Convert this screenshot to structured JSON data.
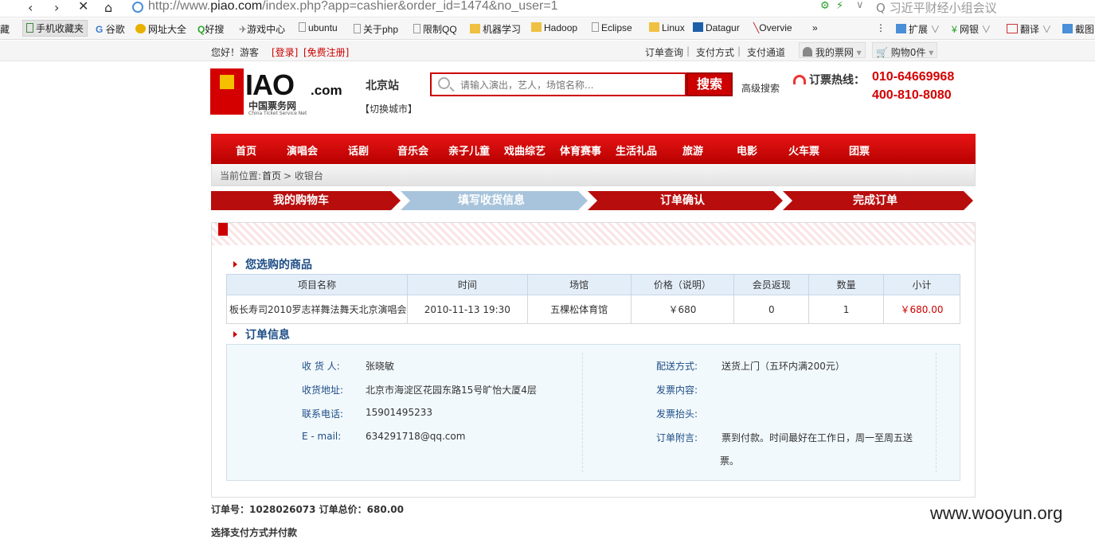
{
  "browser": {
    "url_prefix": "http://www.",
    "url_host": "piao.com",
    "url_path": "/index.php?app=cashier&order_id=1474&no_user=1",
    "search_text": "习近平财经小组会议",
    "bookmarks": [
      "藏",
      "手机收藏夹",
      "谷歌",
      "网址大全",
      "好搜",
      "游戏中心",
      "ubuntu",
      "关于php",
      "限制QQ",
      "机器学习",
      "Hadoop",
      "Eclipse",
      "Linux",
      "Datagur",
      "Overvie",
      "»"
    ],
    "toolbar": [
      "扩展",
      "网银",
      "翻译",
      "截图"
    ]
  },
  "sitebar": {
    "greeting": "您好！游客",
    "login": "[登录]",
    "register": "[免费注册]",
    "links": [
      "订单查询",
      "支付方式",
      "支付通道"
    ],
    "my_account": "我的票网",
    "cart": "购物0件"
  },
  "header": {
    "logo_p": "P",
    "logo_iao": "IAO",
    "logo_com": ".com",
    "logo_cn": "中国票务网",
    "logo_en": "China Ticket Service Net",
    "city": "北京站",
    "city_switch": "【切换城市】",
    "search_placeholder": "请输入演出，艺人，场馆名称...",
    "search_button": "搜索",
    "advanced_search": "高级搜索",
    "hotline_label": "订票热线：",
    "hotline_1": "010-64669968",
    "hotline_2": "400-810-8080"
  },
  "nav": [
    "首页",
    "演唱会",
    "话剧",
    "音乐会",
    "亲子儿童",
    "戏曲综艺",
    "体育赛事",
    "生活礼品",
    "旅游",
    "电影",
    "火车票",
    "团票"
  ],
  "breadcrumb": {
    "prefix": "当前位置:",
    "home": "首页",
    "current": "> 收银台"
  },
  "steps": [
    "我的购物车",
    "填写收货信息",
    "订单确认",
    "完成订单"
  ],
  "goods": {
    "title": "您选购的商品",
    "columns": [
      "项目名称",
      "时间",
      "场馆",
      "价格（说明）",
      "会员返现",
      "数量",
      "小计"
    ],
    "rows": [
      [
        "板长寿司2010罗志祥舞法舞天北京演唱会",
        "2010-11-13 19:30",
        "五棵松体育馆",
        "￥680",
        "0",
        "1",
        "￥680.00"
      ]
    ]
  },
  "order_info": {
    "title": "订单信息",
    "left": [
      {
        "label": "收 货 人:",
        "value": "张晓敏"
      },
      {
        "label": "收货地址:",
        "value": "北京市海淀区花园东路15号旷怡大厦4层"
      },
      {
        "label": "联系电话:",
        "value": "15901495233"
      },
      {
        "label": "E - mail:",
        "value": "634291718@qq.com"
      }
    ],
    "right": [
      {
        "label": "配送方式:",
        "value": "送货上门（五环内满200元）"
      },
      {
        "label": "发票内容:",
        "value": ""
      },
      {
        "label": "发票抬头:",
        "value": ""
      },
      {
        "label": "订单附言:",
        "value": "票到付款。时间最好在工作日，周一至周五送",
        "value2": "票。"
      }
    ]
  },
  "summary": {
    "order_no": "订单号：1028026073 订单总价：680.00",
    "choose_payment": "选择支付方式并付款"
  },
  "watermark": "www.wooyun.org",
  "colors": {
    "brand_red": "#c00000",
    "step_active": "#a8c4dc",
    "link_blue": "#1d4d86"
  }
}
